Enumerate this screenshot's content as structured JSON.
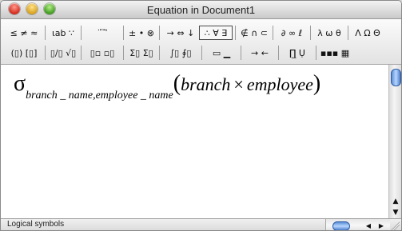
{
  "window": {
    "title": "Equation in Document1"
  },
  "toolbar": {
    "row1": [
      {
        "label": "≤ ≠ ≈",
        "name": "relational-symbols-palette"
      },
      {
        "label": "⍳ab ∵",
        "name": "spaces-ellipses-palette"
      },
      {
        "label": "¨ ⃛ ⃗",
        "name": "embellishments-palette"
      },
      {
        "label": "± • ⊗",
        "name": "operator-symbols-palette"
      },
      {
        "label": "→ ⇔ ↓",
        "name": "arrow-symbols-palette"
      },
      {
        "label": "∴ ∀ ∃",
        "name": "logical-symbols-palette",
        "selected": true
      },
      {
        "label": "∉ ∩ ⊂",
        "name": "set-theory-symbols-palette"
      },
      {
        "label": "∂ ∞ ℓ",
        "name": "miscellaneous-symbols-palette"
      },
      {
        "label": "λ ω θ",
        "name": "greek-lowercase-palette"
      },
      {
        "label": "Λ Ω Θ",
        "name": "greek-uppercase-palette"
      }
    ],
    "row2": [
      {
        "label": "(▯) [▯]",
        "name": "fence-templates-palette"
      },
      {
        "label": "▯/▯ √▯",
        "name": "fraction-radical-templates-palette"
      },
      {
        "label": "▯▫ ▫▯",
        "name": "subscript-superscript-templates-palette"
      },
      {
        "label": "Σ▯ Σ▯",
        "name": "summation-templates-palette"
      },
      {
        "label": "∫▯ ∮▯",
        "name": "integral-templates-palette"
      },
      {
        "label": "▭ ▁",
        "name": "underbar-overbar-templates-palette"
      },
      {
        "label": "→ ←",
        "name": "labeled-arrow-templates-palette"
      },
      {
        "label": "∏̲ Ụ",
        "name": "products-set-theory-templates-palette"
      },
      {
        "label": "▪▪▪ ▦",
        "name": "matrix-templates-palette"
      }
    ]
  },
  "equation": {
    "sigma": "σ",
    "subscript": "branch _ name,employee _ name",
    "open_paren": "(",
    "left_operand": "branch",
    "operator": "×",
    "right_operand": "employee",
    "close_paren": ")"
  },
  "statusbar": {
    "text": "Logical symbols"
  },
  "icons": {
    "close": "close-window-icon",
    "minimize": "minimize-window-icon",
    "zoom": "zoom-window-icon",
    "scroll_up": "▲",
    "scroll_down": "▼",
    "scroll_left": "◀",
    "scroll_right": "▶"
  },
  "colors": {
    "scroll_thumb": "#5c8fd6",
    "close": "#d42a1c",
    "minimize": "#d8a21c",
    "zoom": "#3f9a1f"
  }
}
